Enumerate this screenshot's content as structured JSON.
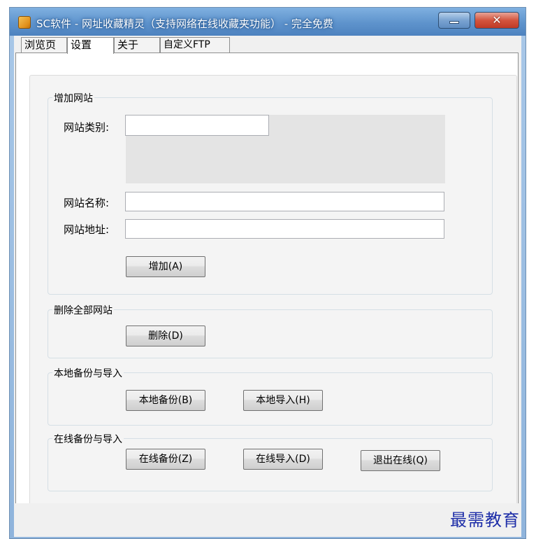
{
  "window": {
    "title": "SC软件 - 网址收藏精灵（支持网络在线收藏夹功能） - 完全免费",
    "minimize_glyph": "—",
    "close_glyph": "✕",
    "icon": "app-icon"
  },
  "tabs": [
    {
      "label": "浏览页",
      "active": false
    },
    {
      "label": "设置",
      "active": true
    },
    {
      "label": "关于",
      "active": false
    },
    {
      "label": "自定义FTP",
      "active": false
    }
  ],
  "add_site": {
    "group_label": "增加网站",
    "category_label": "网站类别:",
    "category_value": "",
    "name_label": "网站名称:",
    "name_value": "",
    "url_label": "网站地址:",
    "url_value": "",
    "add_button": "增加(A)"
  },
  "delete_all": {
    "group_label": "删除全部网站",
    "delete_button": "删除(D)"
  },
  "local_backup": {
    "group_label": "本地备份与导入",
    "backup_button": "本地备份(B)",
    "import_button": "本地导入(H)"
  },
  "online_backup": {
    "group_label": "在线备份与导入",
    "backup_button": "在线备份(Z)",
    "import_button": "在线导入(D)",
    "logout_button": "退出在线(Q)"
  },
  "watermark": "最需教育",
  "colors": {
    "titlebar": "#5e93cc",
    "close_button": "#d4543e",
    "panel": "#f4f4f4",
    "watermark": "#1e2ea8"
  }
}
